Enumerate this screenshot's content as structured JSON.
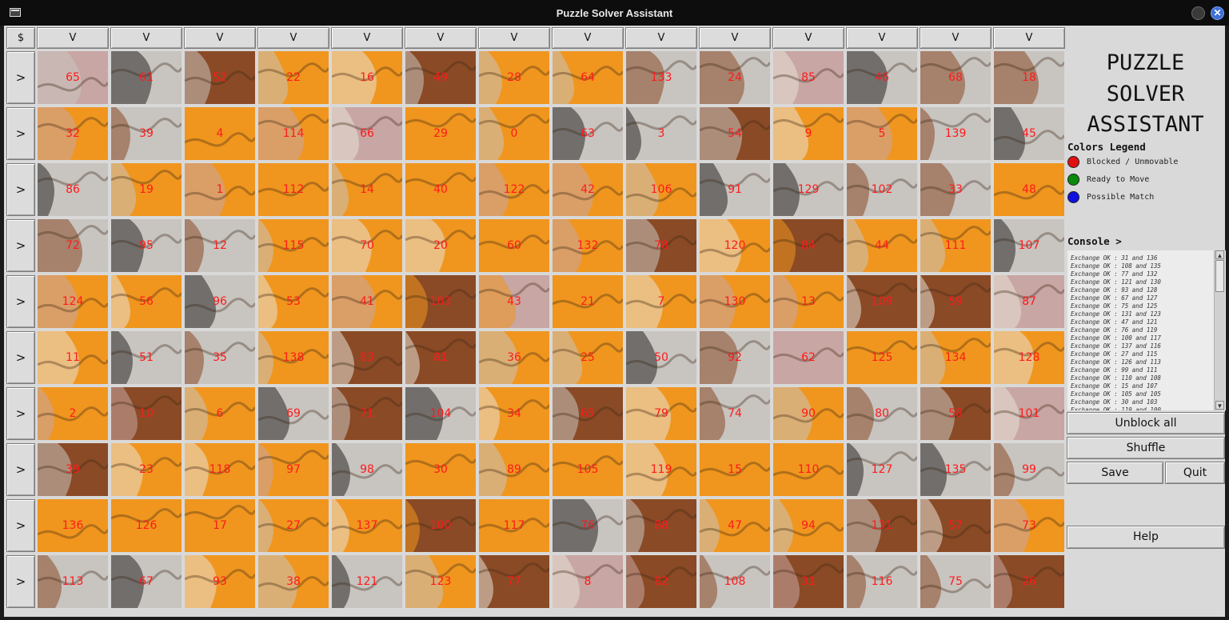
{
  "window": {
    "title": "Puzzle Solver Assistant",
    "close_glyph": "✕"
  },
  "grid": {
    "corner_label": "$",
    "column_label": "V",
    "row_label": ">",
    "rows": [
      [
        65,
        61,
        52,
        22,
        16,
        49,
        28,
        64,
        133,
        24,
        85,
        46,
        68,
        18
      ],
      [
        32,
        39,
        4,
        114,
        66,
        29,
        0,
        63,
        3,
        54,
        9,
        5,
        139,
        45
      ],
      [
        86,
        19,
        1,
        112,
        14,
        40,
        122,
        42,
        106,
        91,
        129,
        102,
        33,
        48
      ],
      [
        72,
        95,
        12,
        115,
        70,
        20,
        60,
        132,
        78,
        120,
        84,
        44,
        111,
        107
      ],
      [
        124,
        56,
        96,
        53,
        41,
        103,
        43,
        21,
        7,
        130,
        13,
        109,
        59,
        87
      ],
      [
        11,
        51,
        35,
        138,
        83,
        81,
        36,
        25,
        50,
        92,
        62,
        125,
        134,
        128
      ],
      [
        2,
        10,
        6,
        69,
        71,
        104,
        34,
        65,
        79,
        74,
        90,
        80,
        58,
        101
      ],
      [
        39,
        23,
        118,
        97,
        98,
        30,
        89,
        105,
        119,
        15,
        110,
        127,
        135,
        99
      ],
      [
        136,
        126,
        17,
        27,
        137,
        100,
        117,
        76,
        88,
        47,
        94,
        131,
        57,
        73
      ],
      [
        113,
        67,
        93,
        38,
        121,
        123,
        77,
        8,
        82,
        108,
        31,
        116,
        75,
        26
      ]
    ]
  },
  "panel": {
    "title_lines": [
      "PUZZLE",
      "SOLVER",
      "ASSISTANT"
    ],
    "legend_title": "Colors Legend",
    "legend": [
      {
        "label": "Blocked / Unmovable",
        "color": "#e01010"
      },
      {
        "label": "Ready to Move",
        "color": "#0a8a0a"
      },
      {
        "label": "Possible Match",
        "color": "#1010e0"
      }
    ],
    "console_title": "Console >",
    "console_lines": [
      "Exchange OK : 31 and 136",
      "Exchange OK : 108 and 135",
      "Exchange OK : 77 and 132",
      "Exchange OK : 121 and 130",
      "Exchange OK : 93 and 128",
      "Exchange OK : 67 and 127",
      "Exchange OK : 75 and 125",
      "Exchange OK : 131 and 123",
      "Exchange OK : 47 and 121",
      "Exchange OK : 76 and 119",
      "Exchange OK : 100 and 117",
      "Exchange OK : 137 and 116",
      "Exchange OK : 27 and 115",
      "Exchange OK : 126 and 113",
      "Exchange OK : 99 and 111",
      "Exchange OK : 110 and 108",
      "Exchange OK : 15 and 107",
      "Exchange OK : 105 and 105",
      "Exchange OK : 30 and 103",
      "Exchange OK : 119 and 100"
    ],
    "buttons": {
      "unblock": "Unblock all",
      "shuffle": "Shuffle",
      "save": "Save",
      "quit": "Quit",
      "help": "Help"
    }
  },
  "colors": {
    "orange": "#f0961e",
    "gray": "#c8c4c0",
    "brown": "#8a4a26",
    "pink": "#c8a6a4",
    "dark": "#2a2826",
    "cream": "#e8e0d4",
    "number": "#ff1a1a"
  }
}
